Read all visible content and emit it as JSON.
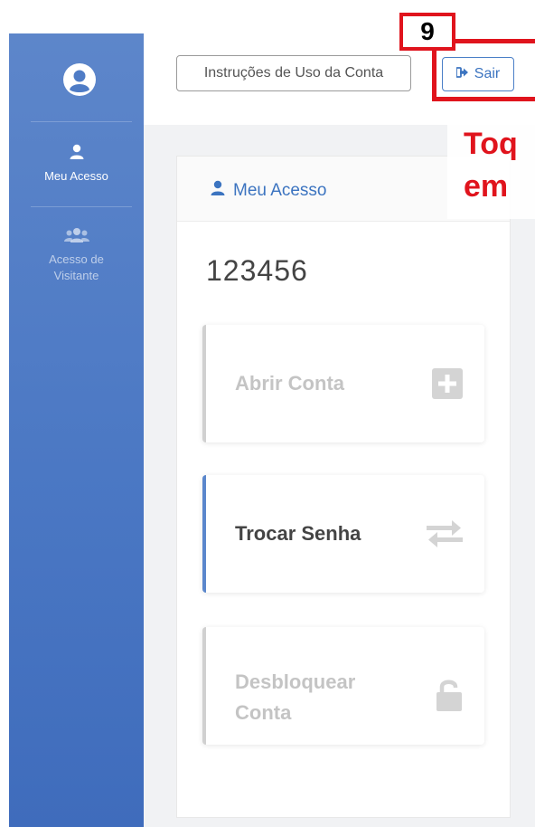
{
  "header": {
    "instructions_label": "Instruções de Uso da Conta",
    "logout_label": "Sair"
  },
  "sidebar": {
    "items": [
      {
        "label": "Meu Acesso",
        "icon": "user-icon",
        "active": true
      },
      {
        "label": "Acesso de Visitante",
        "icon": "users-icon",
        "active": false
      }
    ]
  },
  "card": {
    "title": "Meu Acesso",
    "account_number": "123456",
    "actions": [
      {
        "label": "Abrir Conta",
        "icon": "plus-square-icon",
        "enabled": false
      },
      {
        "label": "Trocar Senha",
        "icon": "exchange-icon",
        "enabled": true
      },
      {
        "label": "Desbloquear Conta",
        "icon": "unlock-icon",
        "enabled": false
      }
    ]
  },
  "annotation": {
    "step_number": "9",
    "instruction_line1": "Toq",
    "instruction_line2": "em"
  },
  "colors": {
    "sidebar_blue": "#4b78c4",
    "accent_blue": "#3c74c0",
    "annotation_red": "#e0141d"
  }
}
